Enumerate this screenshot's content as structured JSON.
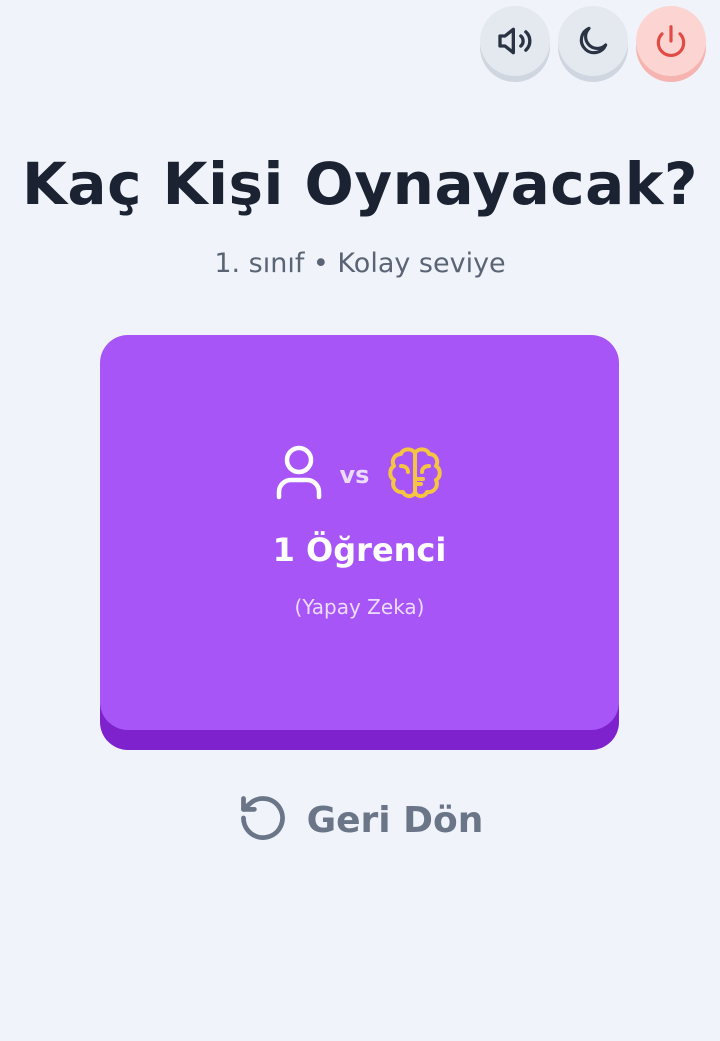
{
  "header": {
    "sound_icon": "volume-icon",
    "theme_icon": "moon-icon",
    "power_icon": "power-icon"
  },
  "page": {
    "title": "Kaç Kişi Oynayacak?",
    "subtitle": "1. sınıf • Kolay seviye"
  },
  "mode_card": {
    "color": "#a855f7",
    "shadow_color": "#7e22ce",
    "left_icon": "user-icon",
    "vs_label": "vs",
    "right_icon": "brain-icon",
    "title": "1 Öğrenci",
    "subtitle": "(Yapay Zeka)"
  },
  "footer": {
    "back_icon": "rotate-ccw-icon",
    "back_label": "Geri Dön"
  },
  "colors": {
    "background": "#f0f4fa",
    "title": "#1b2333",
    "power_accent": "#e24b44",
    "brain_accent": "#f5c542"
  }
}
